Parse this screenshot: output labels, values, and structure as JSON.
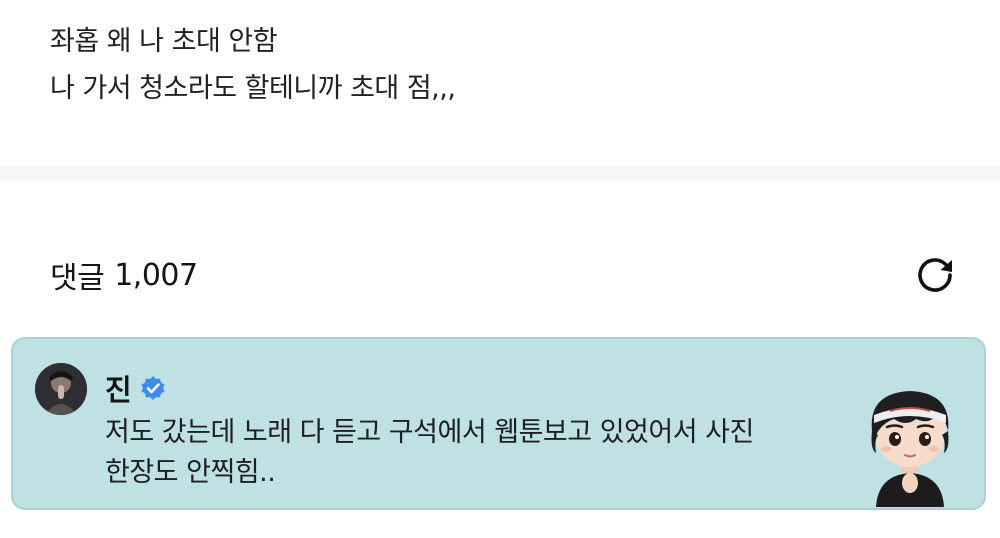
{
  "post": {
    "lines": [
      "좌홉 왜 나 초대 안함",
      "나 가서 청소라도 할테니까 초대 점,,,"
    ]
  },
  "comments": {
    "label": "댓글",
    "count": "1,007",
    "refresh_icon": "refresh-icon"
  },
  "featured_comment": {
    "author": "진",
    "verified_icon": "verified-badge-icon",
    "text_lines": [
      "저도 갔는데 노래 다 듣고 구석에서 웹툰보고 있었어서 사진",
      "한장도 안찍힘.."
    ],
    "background_color": "#bfe1e4",
    "badge_color": "#3d8bf2"
  }
}
